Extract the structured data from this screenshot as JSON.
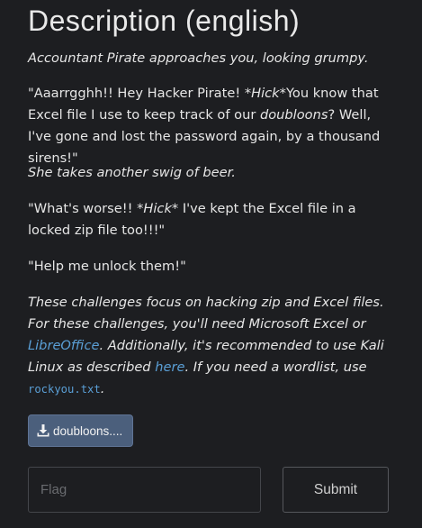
{
  "heading": "Description (english)",
  "paragraphs": {
    "p1": "Accountant Pirate approaches you, looking grumpy.",
    "p2_a": "\"Aaarrgghh!! Hey Hacker Pirate! ",
    "p2_hick": "*Hick*",
    "p2_b": "You know that Excel file I use to keep track of our ",
    "p2_doubloons": "doubloons",
    "p2_c": "? Well, I've gone and lost the password again, by a thousand sirens!\"",
    "p3": "She takes another swig of beer.",
    "p4_a": "\"What's worse!! ",
    "p4_hick": "*Hick*",
    "p4_b": " I've kept the Excel file in a locked zip file too!!!\"",
    "p5": "\"Help me unlock them!\"",
    "p6_a": "These challenges focus on hacking zip and Excel files. For these challenges, you'll need Microsoft Excel or ",
    "p6_libreoffice": "LibreOffice",
    "p6_b": ". Additionally, it's recommended to use Kali Linux as described ",
    "p6_here": "here",
    "p6_c": ". If you need a wordlist, use ",
    "p6_rockyou": "rockyou.txt",
    "p6_d": "."
  },
  "download": {
    "label": "doubloons....",
    "icon": "download-icon"
  },
  "flag": {
    "placeholder": "Flag",
    "value": ""
  },
  "submit_label": "Submit",
  "colors": {
    "background": "#1d1e21",
    "link": "#5a9fd6",
    "download_button": "#4b5f7c"
  }
}
